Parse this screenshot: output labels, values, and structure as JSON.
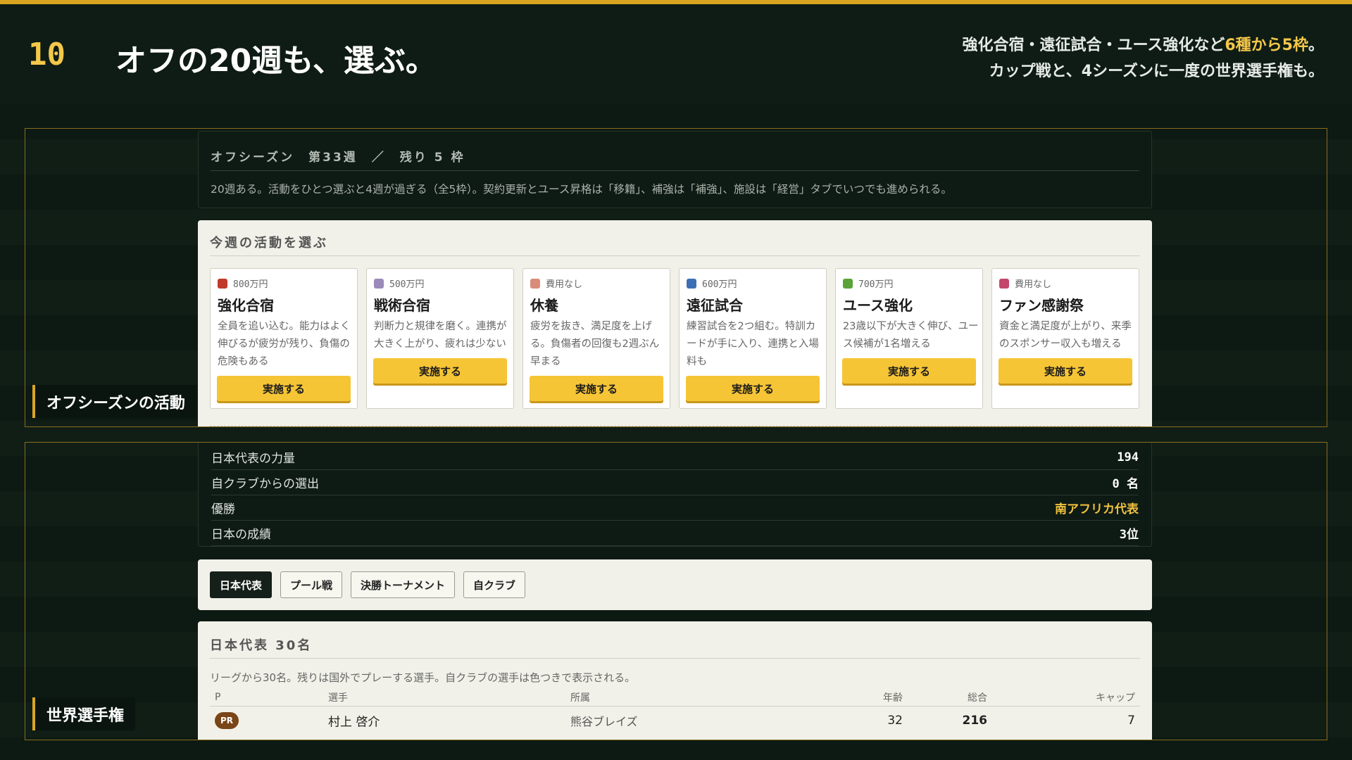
{
  "header": {
    "number": "10",
    "title": "オフの20週も、選ぶ。",
    "sub_line1_pre": "強化合宿・遠征試合・ユース強化など",
    "sub_line1_hl": "6種から5枠",
    "sub_line1_post": "。",
    "sub_line2": "カップ戦と、4シーズンに一度の世界選手権も。"
  },
  "offseason": {
    "section_label": "オフシーズンの活動",
    "status": "オフシーズン　第33週　／　残り 5 枠",
    "description": "20週ある。活動をひとつ選ぶと4週が過ぎる（全5枠）。契約更新とユース昇格は「移籍」、補強は「補強」、施設は「経営」タブでいつでも進められる。",
    "choose_heading": "今週の活動を選ぶ",
    "activities": [
      {
        "cost": "800万円",
        "title": "強化合宿",
        "desc": "全員を追い込む。能力はよく伸びるが疲労が残り、負傷の危険もある",
        "button": "実施する",
        "icon": "dumbbell-icon",
        "icon_color": "#c0392b"
      },
      {
        "cost": "500万円",
        "title": "戦術合宿",
        "desc": "判断力と規律を磨く。連携が大きく上がり、疲れは少ない",
        "button": "実施する",
        "icon": "clipboard-icon",
        "icon_color": "#9b8ab8"
      },
      {
        "cost": "費用なし",
        "title": "休養",
        "desc": "疲労を抜き、満足度を上げる。負傷者の回復も2週ぶん早まる",
        "button": "実施する",
        "icon": "hot-spring-icon",
        "icon_color": "#d98c7a"
      },
      {
        "cost": "600万円",
        "title": "遠征試合",
        "desc": "練習試合を2つ組む。特訓カードが手に入り、連携と入場料も",
        "button": "実施する",
        "icon": "bus-icon",
        "icon_color": "#3d6fb5"
      },
      {
        "cost": "700万円",
        "title": "ユース強化",
        "desc": "23歳以下が大きく伸び、ユース候補が1名増える",
        "button": "実施する",
        "icon": "sprout-icon",
        "icon_color": "#5aa33a"
      },
      {
        "cost": "費用なし",
        "title": "ファン感謝祭",
        "desc": "資金と満足度が上がり、来季のスポンサー収入も増える",
        "button": "実施する",
        "icon": "tent-icon",
        "icon_color": "#c2476b"
      }
    ]
  },
  "world": {
    "section_label": "世界選手権",
    "stats": [
      {
        "label": "日本代表の力量",
        "value": "194",
        "highlight": false
      },
      {
        "label": "自クラブからの選出",
        "value": "0 名",
        "highlight": false
      },
      {
        "label": "優勝",
        "value": "南アフリカ代表",
        "highlight": true
      },
      {
        "label": "日本の成績",
        "value": "3位",
        "highlight": false
      }
    ],
    "tabs": [
      "日本代表",
      "プール戦",
      "決勝トーナメント",
      "自クラブ"
    ],
    "active_tab": 0,
    "roster_heading": "日本代表 30名",
    "roster_desc": "リーグから30名。残りは国外でプレーする選手。自クラブの選手は色つきで表示される。",
    "columns": [
      "P",
      "選手",
      "所属",
      "年齢",
      "総合",
      "キャップ"
    ],
    "rows": [
      {
        "pos": "PR",
        "name": "村上 啓介",
        "team": "熊谷ブレイズ",
        "age": "32",
        "overall": "216",
        "caps": "7"
      }
    ]
  }
}
